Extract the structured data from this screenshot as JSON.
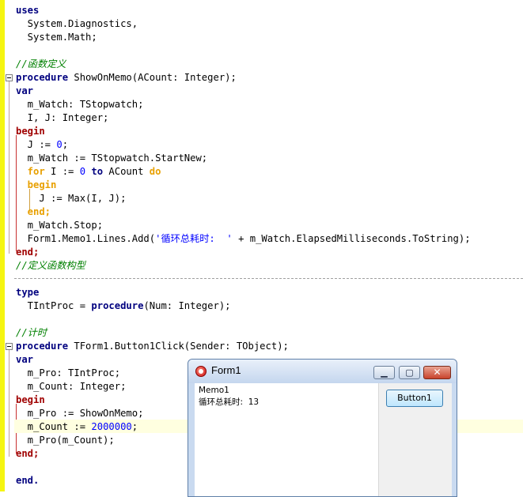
{
  "editor": {
    "lines": [
      {
        "id": "l1",
        "t": "uses"
      },
      {
        "id": "l2",
        "t": "  System.Diagnostics,"
      },
      {
        "id": "l3",
        "t": "  System.Math;"
      },
      {
        "id": "l4",
        "t": ""
      },
      {
        "id": "l5",
        "t": "//函数定义"
      },
      {
        "id": "l6a",
        "t": "procedure"
      },
      {
        "id": "l6b",
        "t": " ShowOnMemo(ACount: Integer);"
      },
      {
        "id": "l7",
        "t": "var"
      },
      {
        "id": "l8",
        "t": "  m_Watch: TStopwatch;"
      },
      {
        "id": "l9",
        "t": "  I, J: Integer;"
      },
      {
        "id": "l10",
        "t": "begin"
      },
      {
        "id": "l11a",
        "t": "  J := "
      },
      {
        "id": "l11b",
        "t": "0"
      },
      {
        "id": "l11c",
        "t": ";"
      },
      {
        "id": "l12",
        "t": "  m_Watch := TStopwatch.StartNew;"
      },
      {
        "id": "l13a",
        "t": "  for"
      },
      {
        "id": "l13b",
        "t": " I := "
      },
      {
        "id": "l13c",
        "t": "0"
      },
      {
        "id": "l13d",
        "t": " to"
      },
      {
        "id": "l13e",
        "t": " ACount "
      },
      {
        "id": "l13f",
        "t": "do"
      },
      {
        "id": "l14",
        "t": "  begin"
      },
      {
        "id": "l15",
        "t": "    J := Max(I, J);"
      },
      {
        "id": "l16",
        "t": "  end;"
      },
      {
        "id": "l17",
        "t": "  m_Watch.Stop;"
      },
      {
        "id": "l18a",
        "t": "  Form1.Memo1.Lines.Add("
      },
      {
        "id": "l18b",
        "t": "'循环总耗时:  '"
      },
      {
        "id": "l18c",
        "t": " + m_Watch.ElapsedMilliseconds.ToString);"
      },
      {
        "id": "l19",
        "t": "end;"
      },
      {
        "id": "l20",
        "t": "//定义函数构型"
      },
      {
        "id": "l21",
        "t": "type"
      },
      {
        "id": "l22a",
        "t": "  TIntProc = "
      },
      {
        "id": "l22b",
        "t": "procedure"
      },
      {
        "id": "l22c",
        "t": "(Num: Integer);"
      },
      {
        "id": "l23",
        "t": "//计时"
      },
      {
        "id": "l24a",
        "t": "procedure"
      },
      {
        "id": "l24b",
        "t": " TForm1.Button1Click(Sender: TObject);"
      },
      {
        "id": "l25",
        "t": "var"
      },
      {
        "id": "l26",
        "t": "  m_Pro: TIntProc;"
      },
      {
        "id": "l27",
        "t": "  m_Count: Integer;"
      },
      {
        "id": "l28",
        "t": "begin"
      },
      {
        "id": "l29",
        "t": "  m_Pro := ShowOnMemo;"
      },
      {
        "id": "l30a",
        "t": "  m_Count := "
      },
      {
        "id": "l30b",
        "t": "2000000"
      },
      {
        "id": "l30c",
        "t": ";"
      },
      {
        "id": "l31",
        "t": "  m_Pro(m_Count);"
      },
      {
        "id": "l32",
        "t": "end;"
      },
      {
        "id": "l33",
        "t": "end."
      }
    ]
  },
  "form_window": {
    "title": "Form1",
    "minimize_glyph": "▁",
    "maximize_glyph": "▢",
    "close_glyph": "✕",
    "memo": {
      "name_line": "Memo1",
      "result_line": "循环总耗时:  13"
    },
    "button1_label": "Button1"
  },
  "colors": {
    "keyword": "#00007f",
    "comment": "#008000",
    "number": "#0000ff",
    "gutter": "#f5f511"
  }
}
